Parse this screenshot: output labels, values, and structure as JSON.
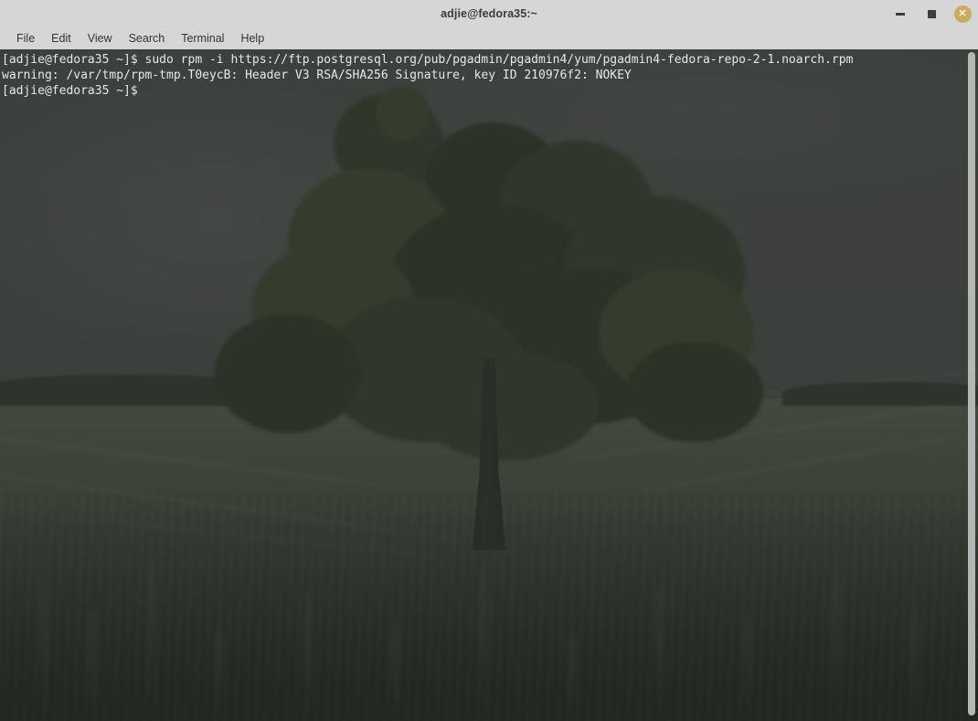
{
  "window": {
    "title": "adjie@fedora35:~",
    "controls": {
      "minimize_label": "–",
      "maximize_label": "⤡",
      "close_label": "✕"
    }
  },
  "menubar": {
    "items": [
      {
        "label": "File",
        "name": "menu-file"
      },
      {
        "label": "Edit",
        "name": "menu-edit"
      },
      {
        "label": "View",
        "name": "menu-view"
      },
      {
        "label": "Search",
        "name": "menu-search"
      },
      {
        "label": "Terminal",
        "name": "menu-terminal"
      },
      {
        "label": "Help",
        "name": "menu-help"
      }
    ]
  },
  "terminal": {
    "lines": [
      "[adjie@fedora35 ~]$ sudo rpm -i https://ftp.postgresql.org/pub/pgadmin/pgadmin4/yum/pgadmin4-fedora-repo-2-1.noarch.rpm",
      "warning: /var/tmp/rpm-tmp.T0eycB: Header V3 RSA/SHA256 Signature, key ID 210976f2: NOKEY",
      "[adjie@fedora35 ~]$"
    ],
    "text": "[adjie@fedora35 ~]$ sudo rpm -i https://ftp.postgresql.org/pub/pgadmin/pgadmin4/yum/pgadmin4-fedora-repo-2-1.noarch.rpm\nwarning: /var/tmp/rpm-tmp.T0eycB: Header V3 RSA/SHA256 Signature, key ID 210976f2: NOKEY\n[adjie@fedora35 ~]$",
    "prompt": "[adjie@fedora35 ~]$",
    "command": "sudo rpm -i https://ftp.postgresql.org/pub/pgadmin/pgadmin4/yum/pgadmin4-fedora-repo-2-1.noarch.rpm",
    "warning": "warning: /var/tmp/rpm-tmp.T0eycB: Header V3 RSA/SHA256 Signature, key ID 210976f2: NOKEY"
  },
  "colors": {
    "titlebar_bg": "#d6d6d6",
    "menubar_bg": "#d6d6d6",
    "close_button": "#c9ab63",
    "terminal_text": "#e8e8e6",
    "scrollbar_thumb": "#b5b8b2"
  }
}
